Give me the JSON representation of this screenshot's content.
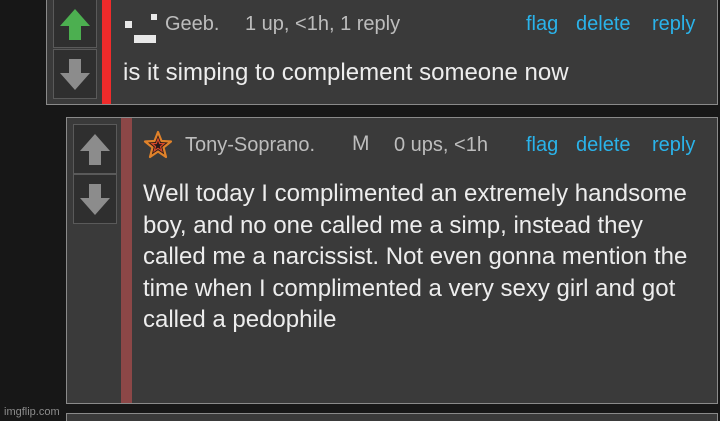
{
  "comments": [
    {
      "username": "Geeb.",
      "stats": "1 up, <1h, 1 reply",
      "text": "is it simping to complement someone now",
      "actions": {
        "flag": "flag",
        "delete": "delete",
        "reply": "reply"
      },
      "upvoted": true,
      "stripe_color": "#ef2b2b"
    },
    {
      "username": "Tony-Soprano.",
      "badge": "M",
      "stats": "0 ups, <1h",
      "text": "Well today I complimented an extremely handsome boy, and no one called me a simp, instead they called me a narcissist. Not even gonna mention the time when I complimented a very sexy girl and got called a pedophile",
      "actions": {
        "flag": "flag",
        "delete": "delete",
        "reply": "reply"
      },
      "upvoted": false,
      "stripe_color": "#8c4747"
    }
  ],
  "colors": {
    "upvote_active": "#4caf50",
    "vote_inactive": "#8c8c8c",
    "link": "#2ab3ea"
  },
  "watermark": "imgflip.com"
}
